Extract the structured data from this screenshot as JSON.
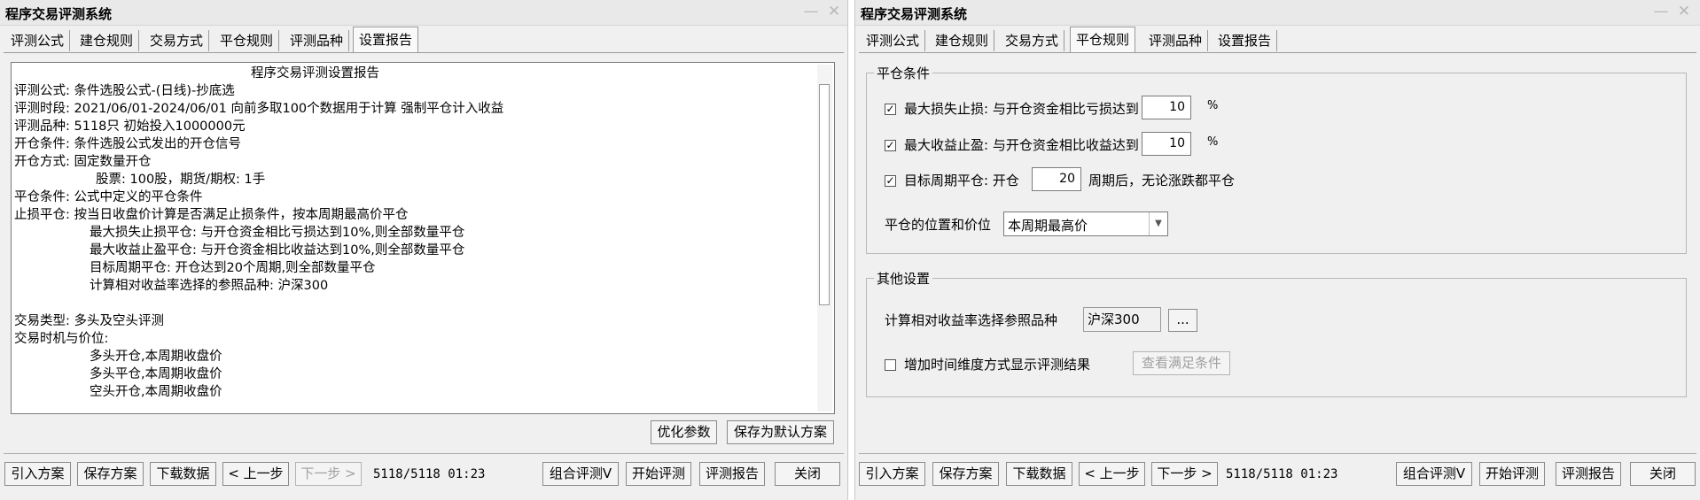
{
  "left": {
    "title": "程序交易评测系统",
    "tabs": [
      "评测公式",
      "建仓规则",
      "交易方式",
      "平仓规则",
      "评测品种",
      "设置报告"
    ],
    "report_lines": [
      "程序交易评测设置报告",
      "评测公式: 条件选股公式-(日线)-抄底选",
      "评测时段: 2021/06/01-2024/06/01 向前多取100个数据用于计算 强制平仓计入收益",
      "评测品种: 5118只 初始投入1000000元",
      "开仓条件: 条件选股公式发出的开仓信号",
      "开仓方式: 固定数量开仓",
      "股票: 100股，期货/期权: 1手",
      "平仓条件: 公式中定义的平仓条件",
      "止损平仓: 按当日收盘价计算是否满足止损条件，按本周期最高价平仓",
      "最大损失止损平仓: 与开仓资金相比亏损达到10%,则全部数量平仓",
      "最大收益止盈平仓: 与开仓资金相比收益达到10%,则全部数量平仓",
      "目标周期平仓: 开仓达到20个周期,则全部数量平仓",
      "计算相对收益率选择的参照品种: 沪深300",
      "交易类型: 多头及空头评测",
      "交易时机与价位:",
      "多头开仓,本周期收盘价",
      "多头平仓,本周期收盘价",
      "空头开仓,本周期收盘价"
    ],
    "buttons": {
      "optimize": "优化参数",
      "save_default": "保存为默认方案"
    }
  },
  "right": {
    "title": "程序交易评测系统",
    "tabs": [
      "评测公式",
      "建仓规则",
      "交易方式",
      "平仓规则",
      "评测品种",
      "设置报告"
    ],
    "close_group": {
      "label": "平仓条件",
      "max_loss": {
        "label": "最大损失止损: 与开仓资金相比亏损达到",
        "value": "10",
        "unit": "%",
        "checked": true
      },
      "max_gain": {
        "label": "最大收益止盈: 与开仓资金相比收益达到",
        "value": "10",
        "unit": "%",
        "checked": true
      },
      "target_period": {
        "label": "目标周期平仓: 开仓",
        "value": "20",
        "suffix": "周期后，无论涨跌都平仓",
        "checked": true
      },
      "position_label": "平仓的位置和价位",
      "position_value": "本周期最高价"
    },
    "other_group": {
      "label": "其他设置",
      "ref_label": "计算相对收益率选择参照品种",
      "ref_value": "沪深300",
      "browse": "...",
      "time_dim_label": "增加时间维度方式显示评测结果",
      "time_dim_checked": false,
      "view_conditions": "查看满足条件"
    }
  },
  "footer": {
    "import": "引入方案",
    "save": "保存方案",
    "download": "下载数据",
    "prev": "< 上一步",
    "next": "下一步 >",
    "status": "5118/5118 01:23",
    "combo_eval": "组合评测V",
    "start_eval": "开始评测",
    "report": "评测报告",
    "close": "关闭"
  },
  "icons": {
    "minimize": "minimize-icon",
    "close": "close-icon",
    "check": "checkmark-icon",
    "dropdown": "chevron-down-icon"
  }
}
